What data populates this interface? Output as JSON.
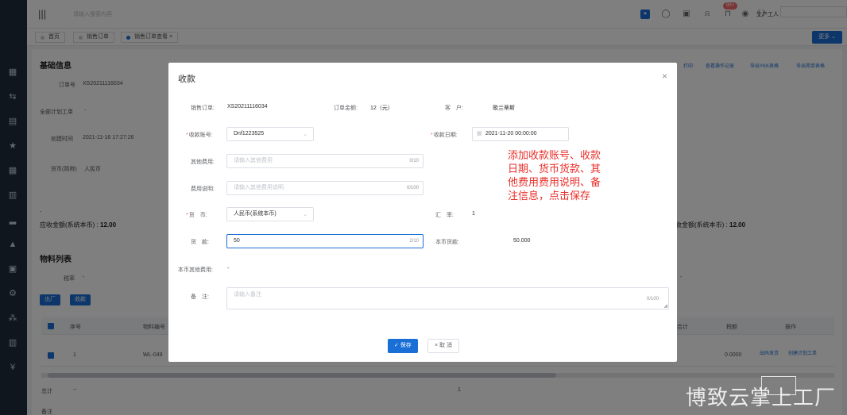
{
  "topbar": {
    "search_placeholder": "请输入搜索内容",
    "notification_count": "99+",
    "username": "生产工人"
  },
  "tabs": [
    {
      "label": "首页"
    },
    {
      "label": "销售订单"
    },
    {
      "label": "销售订单查看",
      "close": "×"
    }
  ],
  "more_button": "更多 ⌄",
  "background": {
    "section_basic": "基础信息",
    "order_no_label": "订单号",
    "order_no": "XS20211116034",
    "plan_label": "全部计划工单",
    "plan_value": "-",
    "created_label": "创建时间",
    "created_value": "2021-11-16 17:27:26",
    "currency_label": "货币(简称)",
    "currency_value": "人民币",
    "dash_left": "-",
    "receivable_label": "应收金额(系统本币) :",
    "receivable_value": "12.00",
    "received_label": "收金额(系统本币) :",
    "received_value": "12.00",
    "actions": [
      "打印",
      "查看操作记录",
      "导出YKK表格",
      "导出简单表格"
    ],
    "materials_title": "物料列表",
    "tax_label": "税率",
    "tax_value": "-",
    "dash_right": "-",
    "btn_out": "出厂",
    "btn_collect": "收款",
    "col_index": "序号",
    "col_code": "物料编号",
    "col_total": "合计",
    "col_tax": "税额",
    "col_ops": "操作",
    "row_index": "1",
    "row_code": "WL-049",
    "row_amount": "0.0000",
    "row_op1": "出码发货",
    "row_op2": "创建计划工单",
    "sum_label": "总计",
    "sum_dash": "--",
    "sum_one": "1",
    "footer_text": "备注"
  },
  "modal": {
    "title": "收款",
    "close": "×",
    "sales_order_label": "销售订单:",
    "sales_order_value": "XS20211116034",
    "order_amount_label": "订单金额:",
    "order_amount_value": "12（元）",
    "customer_label": "客　户:",
    "customer_value": "歌兰蒂斯",
    "account_label": "收款账号:",
    "account_value": "Dnf1223525",
    "date_label": "收款日期:",
    "date_value": "2021-11-20 00:00:00",
    "other_fee_label": "其他费用:",
    "other_fee_placeholder": "请输入其他费用",
    "other_fee_count": "0/10",
    "fee_desc_label": "费用说明:",
    "fee_desc_placeholder": "请输入其他费用说明",
    "fee_desc_count": "0/100",
    "currency_label": "货　币:",
    "currency_value": "人民币(系统本币)",
    "rate_label": "汇　率:",
    "rate_value": "1",
    "payment_label": "货　款:",
    "payment_value": "50",
    "payment_count": "2/10",
    "local_payment_label": "本币货款:",
    "local_payment_value": "50.000",
    "local_other_label": "本币其他费用:",
    "local_other_value": "-",
    "remark_label": "备　注:",
    "remark_placeholder": "请输入备注",
    "remark_count": "0/100",
    "save_button": "✓ 保存",
    "cancel_button": "× 取 消"
  },
  "annotation": "添加收款账号、收款日期、货币货款、其他费用费用说明、备注信息，点击保存",
  "watermark": "博致云掌上工厂",
  "colors": {
    "accent": "#1a6fd6",
    "annotation": "#e8302b",
    "required": "#f56c6c"
  }
}
